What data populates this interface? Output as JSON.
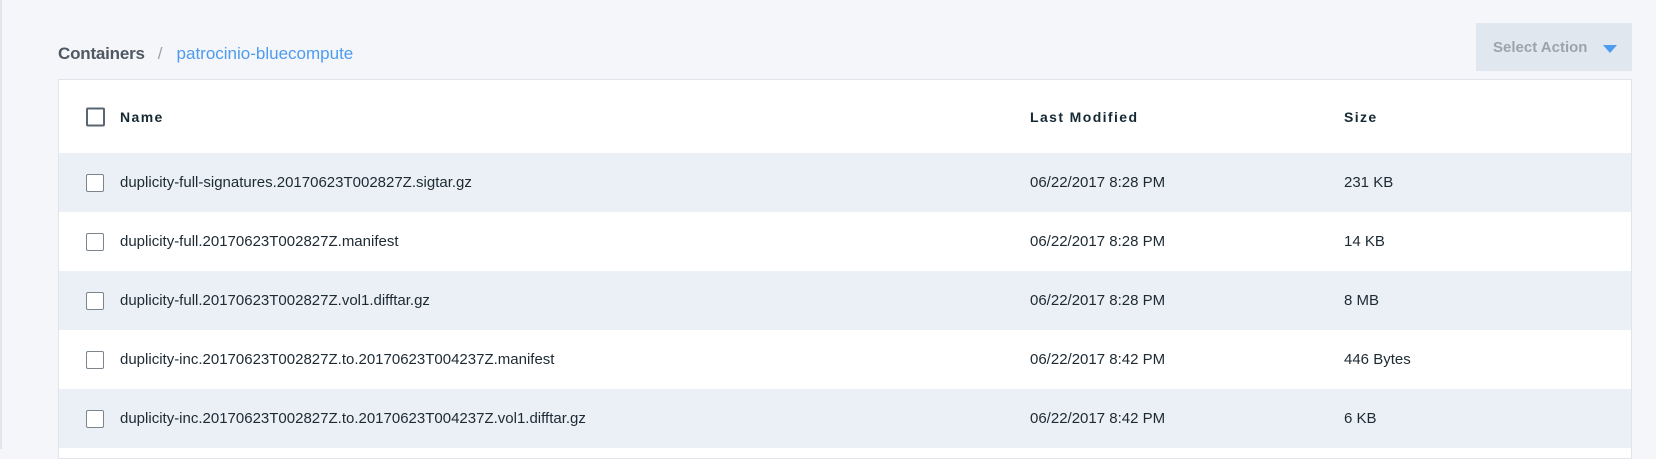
{
  "breadcrumb": {
    "root": "Containers",
    "separator": "/",
    "current": "patrocinio-bluecompute"
  },
  "actions": {
    "select_action_label": "Select Action",
    "caret_icon": "chevron-down-icon"
  },
  "table": {
    "headers": {
      "name": "Name",
      "last_modified": "Last Modified",
      "size": "Size"
    },
    "rows": [
      {
        "name": "duplicity-full-signatures.20170623T002827Z.sigtar.gz",
        "last_modified": "06/22/2017 8:28 PM",
        "size": "231 KB"
      },
      {
        "name": "duplicity-full.20170623T002827Z.manifest",
        "last_modified": "06/22/2017 8:28 PM",
        "size": "14 KB"
      },
      {
        "name": "duplicity-full.20170623T002827Z.vol1.difftar.gz",
        "last_modified": "06/22/2017 8:28 PM",
        "size": "8 MB"
      },
      {
        "name": "duplicity-inc.20170623T002827Z.to.20170623T004237Z.manifest",
        "last_modified": "06/22/2017 8:42 PM",
        "size": "446 Bytes"
      },
      {
        "name": "duplicity-inc.20170623T002827Z.to.20170623T004237Z.vol1.difftar.gz",
        "last_modified": "06/22/2017 8:42 PM",
        "size": "6 KB"
      }
    ]
  },
  "colors": {
    "link": "#4e9bf0",
    "stripe": "#ebf0f6",
    "page_background": "#f4f6f9",
    "button_background": "#e1e7ee"
  }
}
